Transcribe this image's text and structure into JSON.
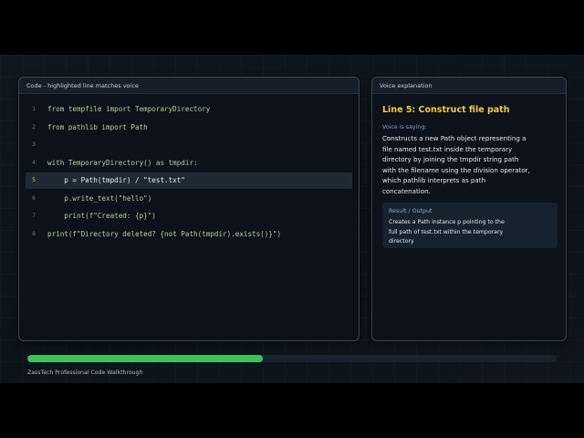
{
  "code_panel": {
    "header": "Code - highlighted line matches voice",
    "active_line": 5,
    "lines": [
      {
        "no": "1",
        "text": "from tempfile import TemporaryDirectory"
      },
      {
        "no": "2",
        "text": "from pathlib import Path"
      },
      {
        "no": "3",
        "text": ""
      },
      {
        "no": "4",
        "text": "with TemporaryDirectory() as tmpdir:"
      },
      {
        "no": "5",
        "text": "    p = Path(tmpdir) / \"test.txt\""
      },
      {
        "no": "6",
        "text": "    p.write_text(\"hello\")"
      },
      {
        "no": "7",
        "text": "    print(f\"Created: {p}\")"
      },
      {
        "no": "8",
        "text": "print(f\"Directory deleted? {not Path(tmpdir).exists()}\")"
      }
    ]
  },
  "voice_panel": {
    "header": "Voice explanation",
    "title": "Line 5: Construct file path",
    "subtitle": "Voice is saying:",
    "text": "Constructs a new Path object representing a file named test.txt inside the temporary directory by joining the tmpdir string path with the filename using the division operator, which pathlib interprets as path concatenation.",
    "result_label": "Result / Output",
    "result_text": "Creates a Path instance p pointing to the full path of test.txt within the temporary directory"
  },
  "progress": {
    "value": 0.445
  },
  "footer": {
    "text": "ZassTech Professional Code Walkthrough"
  },
  "colors": {
    "accent": "#f2c94c",
    "progress": "#3fbf5c",
    "code_text": "#b7d39a",
    "label_blue": "#7fa6d6"
  }
}
